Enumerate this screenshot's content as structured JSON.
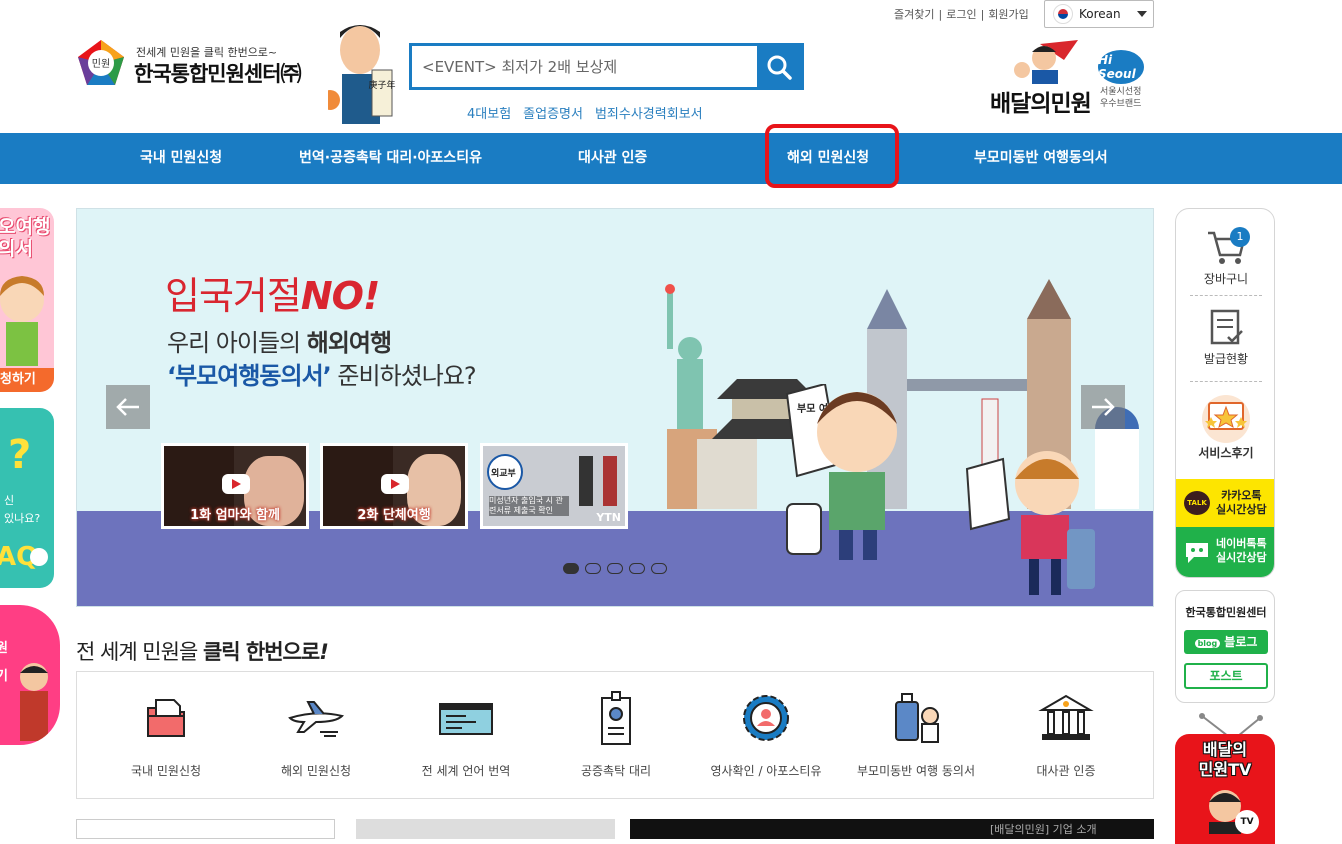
{
  "top_links": {
    "favorites": "즐겨찾기",
    "login": "로그인",
    "signup": "회원가입",
    "sep": "|"
  },
  "language": {
    "selected": "Korean"
  },
  "logo": {
    "badge": "민원",
    "tagline": "전세계 민원을 클릭 한번으로~",
    "name": "한국통합민원센터㈜",
    "seal": "庚子年"
  },
  "search": {
    "value": "<EVENT> 최저가 2배 보상제"
  },
  "quick_links": [
    "4대보험",
    "졸업증명서",
    "범죄수사경력회보서"
  ],
  "brand": {
    "name": "배달의민원",
    "badge": "Hi Seoul",
    "line1": "서울시선정",
    "line2": "우수브랜드"
  },
  "nav": [
    "국내 민원신청",
    "번역·공증촉탁 대리·아포스티유",
    "대사관 인증",
    "해외 민원신청",
    "부모미동반 여행동의서"
  ],
  "left_promos": {
    "p1_top": "오여행",
    "p1_top2": "의서",
    "p1_bottom": "청하기",
    "p2_q": "?",
    "p2_text1": "신",
    "p2_text2": "있나요?",
    "p2_faq": "AQ",
    "p3_text": "원",
    "p3_text2": "기"
  },
  "banner": {
    "headline_pre": "입국거절",
    "headline_em": "NO",
    "headline_mark": "!",
    "line1_pre": "우리 아이들의 ",
    "line1_bold": "해외여행",
    "line2_quote": "‘부모여행동의서’",
    "line2_rest": " 준비하셨나요?",
    "doc_label": "부모 여행 동의서",
    "thumbs": [
      {
        "caption": "1화 엄마와 함께"
      },
      {
        "caption": "2화 단체여행"
      },
      {
        "caption": "YTN",
        "sub": "외교부",
        "note": "미성년자 출입국 시 관련서류 제출국 확인"
      }
    ],
    "slides_total": 5,
    "slide_active": 1
  },
  "section": {
    "pre": "전 세계 민원을 ",
    "bold": "클릭 한번으로",
    "mark": "!"
  },
  "services": [
    {
      "label": "국내 민원신청",
      "icon": "folder-icon"
    },
    {
      "label": "해외 민원신청",
      "icon": "airplane-icon"
    },
    {
      "label": "전 세계 언어 번역",
      "icon": "ticket-icon"
    },
    {
      "label": "공증촉탁 대리",
      "icon": "id-badge-icon"
    },
    {
      "label": "영사확인 / 아포스티유",
      "icon": "gear-person-icon"
    },
    {
      "label": "부모미동반 여행 동의서",
      "icon": "luggage-icon"
    },
    {
      "label": "대사관 인증",
      "icon": "building-icon"
    }
  ],
  "bottom_card_text": "[배달의민원] 기업 소개",
  "sidebar": {
    "cart": "장바구니",
    "cart_count": "1",
    "issue": "발급현황",
    "review": "서비스후기",
    "kakao_badge": "TALK",
    "kakao_line1": "카카오톡",
    "kakao_line2": "실시간상담",
    "naver_line1": "네이버톡톡",
    "naver_line2": "실시간상담"
  },
  "social": {
    "title": "한국통합민원센터",
    "blog_badge": "blog",
    "blog": "블로그",
    "post": "포스트"
  },
  "tv": {
    "line1": "배달의",
    "line2": "민원TV",
    "badge": "TV"
  },
  "colors": {
    "primary": "#1a7cc3",
    "highlight": "#e8141a",
    "kakao": "#fde500",
    "naver": "#20b14a"
  }
}
